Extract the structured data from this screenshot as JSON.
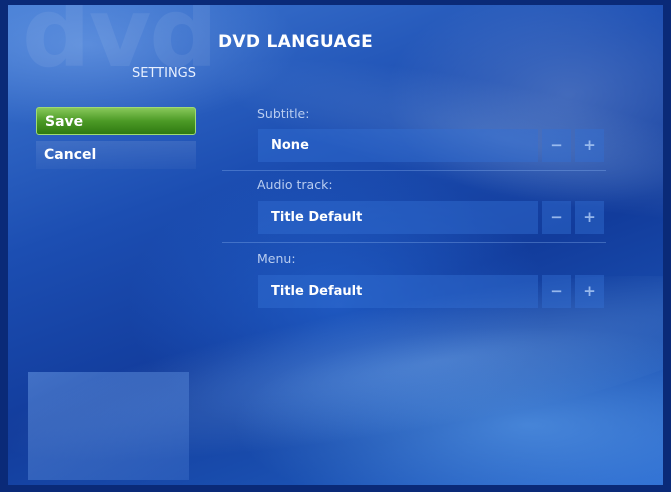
{
  "watermark": "dvd",
  "page": {
    "title": "DVD LANGUAGE",
    "section": "SETTINGS"
  },
  "nav": {
    "save_label": "Save",
    "cancel_label": "Cancel"
  },
  "fields": [
    {
      "label": "Subtitle:",
      "value": "None",
      "minus": "−",
      "plus": "+"
    },
    {
      "label": "Audio track:",
      "value": "Title Default",
      "minus": "−",
      "plus": "+"
    },
    {
      "label": "Menu:",
      "value": "Title Default",
      "minus": "−",
      "plus": "+"
    }
  ]
}
